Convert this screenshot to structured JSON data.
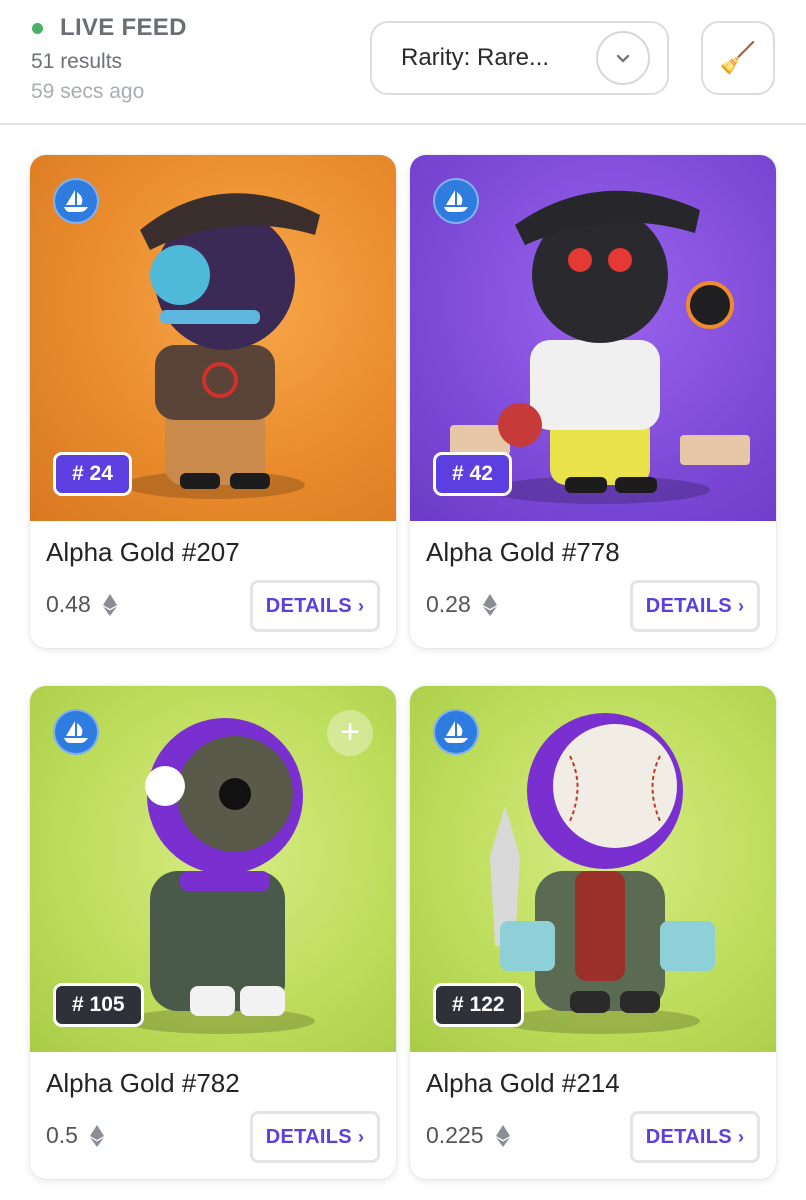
{
  "header": {
    "live_label": "LIVE FEED",
    "results": "51 results",
    "updated": "59 secs ago",
    "live_color": "#4caf6a"
  },
  "filter": {
    "label": "Rarity: Rare...",
    "chevron_icon": "chevron-down-icon",
    "clear_icon": "broom-icon"
  },
  "colors": {
    "accent": "#5b3fe0",
    "opensea": "#2e7ce0",
    "badge_dark": "#2f3138"
  },
  "cards": [
    {
      "name": "Alpha Gold #207",
      "price": "0.48",
      "rank": "# 24",
      "details": "DETAILS",
      "chevron": "›"
    },
    {
      "name": "Alpha Gold #778",
      "price": "0.28",
      "rank": "# 42",
      "details": "DETAILS",
      "chevron": "›"
    },
    {
      "name": "Alpha Gold #782",
      "price": "0.5",
      "rank": "# 105",
      "details": "DETAILS",
      "chevron": "›",
      "plus": "+"
    },
    {
      "name": "Alpha Gold #214",
      "price": "0.225",
      "rank": "# 122",
      "details": "DETAILS",
      "chevron": "›"
    }
  ]
}
